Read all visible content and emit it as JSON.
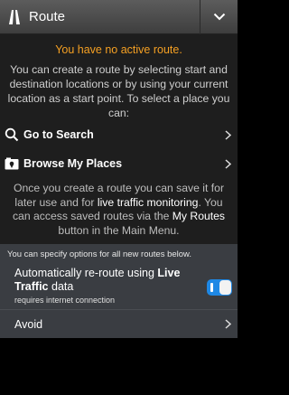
{
  "header": {
    "title": "Route",
    "route_icon": "road-icon",
    "menu_icon": "chevron-down-icon"
  },
  "main": {
    "status": "You have no active route.",
    "intro": "You can create a route by selecting start and destination locations or by using your current location as a start point. To select a place you can:",
    "actions": [
      {
        "label": "Go to Search",
        "icon": "search-icon"
      },
      {
        "label": "Browse My Places",
        "icon": "places-icon"
      }
    ],
    "info_part1": "Once you create a route you can save it for later use and for ",
    "info_hl1": "live traffic monitoring",
    "info_part2": ". You can access saved routes via the ",
    "info_hl2": "My Routes",
    "info_part3": " button in the Main Menu."
  },
  "options": {
    "note": "You can specify options for all new routes below.",
    "reroute_part1": "Automatically re-route using ",
    "reroute_bold": "Live Traffic",
    "reroute_part2": " data",
    "requires": "requires internet connection",
    "toggle_on": true,
    "avoid_label": "Avoid"
  },
  "colors": {
    "accent_orange": "#f5a023",
    "toggle_blue": "#1e88e5"
  }
}
